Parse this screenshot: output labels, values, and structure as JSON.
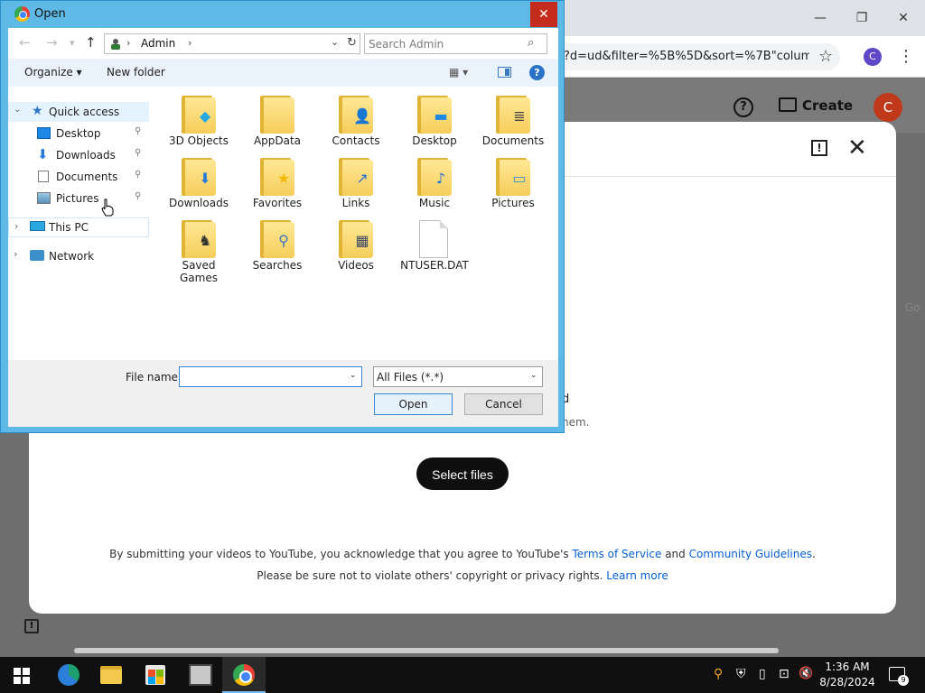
{
  "browser": {
    "url_text": "?d=ud&filter=%5B%5D&sort=%7B\"colum...",
    "profile_initial": "C",
    "minimize_glyph": "—",
    "restore_glyph": "❐",
    "close_glyph": "✕",
    "star_glyph": "☆",
    "menu_glyph": "⋮"
  },
  "youtube": {
    "help_glyph": "?",
    "create_label": "Create",
    "avatar_initial": "C",
    "feedback_glyph": "!",
    "close_glyph": "✕",
    "drag_text_tail": "d",
    "drag_subtext_tail": "hem.",
    "select_files_label": "Select files",
    "terms_prefix": "By submitting your videos to YouTube, you acknowledge that you agree to YouTube's ",
    "terms_link": "Terms of Service",
    "terms_and": " and ",
    "guidelines_link": "Community Guidelines",
    "terms_suffix": ".",
    "privacy_text": "Please be sure not to violate others' copyright or privacy rights. ",
    "learn_more_link": "Learn more",
    "right_clip_text": "Go"
  },
  "dialog": {
    "title": "Open",
    "close_glyph": "✕",
    "nav": {
      "back_glyph": "←",
      "forward_glyph": "→",
      "recent_glyph": "▾",
      "up_glyph": "↑"
    },
    "address": {
      "path": "Admin",
      "sep1": "›",
      "sep2": "›",
      "dropdown_glyph": "⌄",
      "refresh_glyph": "↻"
    },
    "search": {
      "placeholder": "Search Admin",
      "value": "",
      "icon_glyph": "⌕"
    },
    "commands": {
      "organize": "Organize ▾",
      "new_folder": "New folder",
      "view_glyph": "▦ ▾",
      "help_glyph": "?"
    },
    "sidebar": {
      "quick_access": "Quick access",
      "desktop": "Desktop",
      "downloads": "Downloads",
      "documents": "Documents",
      "pictures": "Pictures",
      "this_pc": "This PC",
      "network": "Network",
      "pin_glyph": "📌",
      "expand_glyph": "›",
      "collapse_glyph": "⌄"
    },
    "files": [
      {
        "label": "3D Objects",
        "badge": "◆",
        "badge_color": "#29a8e0"
      },
      {
        "label": "AppData",
        "badge": "",
        "badge_color": "#e8e8e8"
      },
      {
        "label": "Contacts",
        "badge": "👤",
        "badge_color": "#4a7ab8"
      },
      {
        "label": "Desktop",
        "badge": "▬",
        "badge_color": "#1e88e5"
      },
      {
        "label": "Documents",
        "badge": "≣",
        "badge_color": "#444444"
      },
      {
        "label": "Downloads",
        "badge": "⬇",
        "badge_color": "#2a7ad8"
      },
      {
        "label": "Favorites",
        "badge": "★",
        "badge_color": "#f5b800"
      },
      {
        "label": "Links",
        "badge": "↗",
        "badge_color": "#2a6ad0"
      },
      {
        "label": "Music",
        "badge": "♪",
        "badge_color": "#1e6fd6"
      },
      {
        "label": "Pictures",
        "badge": "▭",
        "badge_color": "#3a8fc8"
      },
      {
        "label": "Saved Games",
        "badge": "♞",
        "badge_color": "#333333"
      },
      {
        "label": "Searches",
        "badge": "⚲",
        "badge_color": "#3a78c2"
      },
      {
        "label": "Videos",
        "badge": "▦",
        "badge_color": "#3a4a6a"
      },
      {
        "label": "NTUSER.DAT",
        "type": "file"
      }
    ],
    "bottom": {
      "file_name_label": "File name:",
      "file_name_value": "",
      "dropdown_glyph": "⌄",
      "filter": "All Files (*.*)",
      "open_label": "Open",
      "cancel_label": "Cancel"
    }
  },
  "taskbar": {
    "time": "1:36 AM",
    "date": "8/28/2024",
    "notification_count": "9",
    "tray_glyphs": {
      "search": "⚲",
      "shield": "⛨",
      "usb": "▯",
      "network": "⊡",
      "volume": "🔇"
    }
  },
  "colors": {
    "dialog_frame": "#5fb9e6",
    "close_red": "#c42b1c",
    "yt_button": "#0f0f0f",
    "yt_link": "#065fd4",
    "avatar": "#c0391b",
    "taskbar": "#101010"
  }
}
